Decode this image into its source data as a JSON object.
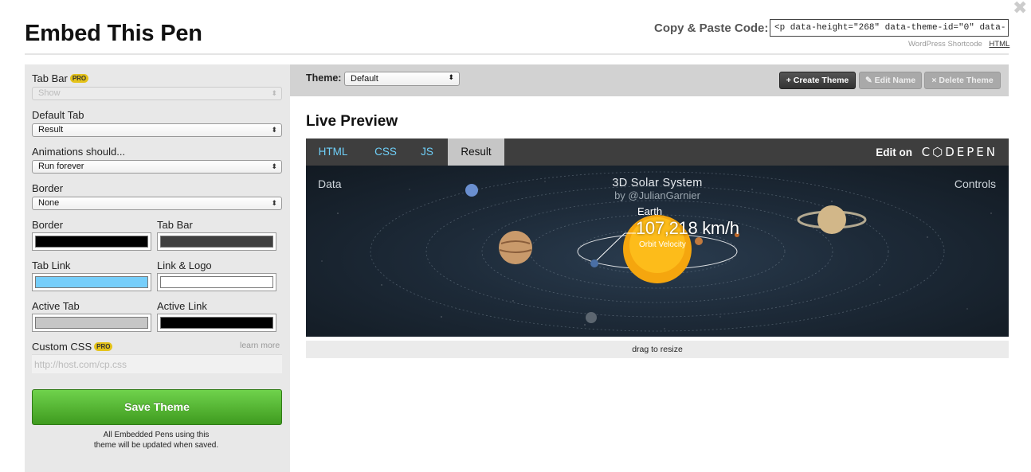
{
  "header": {
    "title": "Embed This Pen",
    "close_glyph": "✖",
    "copy_label": "Copy & Paste Code:",
    "copy_code": "<p data-height=\"268\" data-theme-id=\"0\" data-",
    "links": {
      "wordpress": "WordPress Shortcode",
      "html": "HTML"
    }
  },
  "sidebar": {
    "tab_bar": {
      "label": "Tab Bar",
      "badge": "PRO",
      "value": "Show"
    },
    "default_tab": {
      "label": "Default Tab",
      "value": "Result"
    },
    "animations": {
      "label": "Animations should...",
      "value": "Run forever"
    },
    "border_style": {
      "label": "Border",
      "value": "None"
    },
    "colors": {
      "border": {
        "label": "Border",
        "color": "#000000"
      },
      "tab_bar": {
        "label": "Tab Bar",
        "color": "#3f3f3f"
      },
      "tab_link": {
        "label": "Tab Link",
        "color": "#76cefa"
      },
      "link_logo": {
        "label": "Link & Logo",
        "color": "#ffffff"
      },
      "active_tab": {
        "label": "Active Tab",
        "color": "#c6c6c6"
      },
      "active_link": {
        "label": "Active Link",
        "color": "#000000"
      }
    },
    "custom_css": {
      "label": "Custom CSS",
      "badge": "PRO",
      "learn_more": "learn more",
      "placeholder": "http://host.com/cp.css"
    },
    "save_button": "Save Theme",
    "save_note": "All Embedded Pens using this theme will be updated when saved."
  },
  "toolbar": {
    "theme_label": "Theme:",
    "theme_value": "Default",
    "create_button": "+ Create Theme",
    "edit_button": "✎ Edit Name",
    "delete_button": "× Delete Theme"
  },
  "preview": {
    "title": "Live Preview",
    "tabs": [
      {
        "label": "HTML"
      },
      {
        "label": "CSS"
      },
      {
        "label": "JS"
      },
      {
        "label": "Result",
        "active": true
      }
    ],
    "edit_on": "Edit on",
    "logo_text": "C⬡DEPEN",
    "result": {
      "data_label": "Data",
      "controls_label": "Controls",
      "title": "3D Solar System",
      "subtitle": "by @JulianGarnier",
      "planet": "Earth",
      "speed": "107,218 km/h",
      "speed_label": "Orbit Velocity"
    },
    "resize_label": "drag to resize"
  }
}
